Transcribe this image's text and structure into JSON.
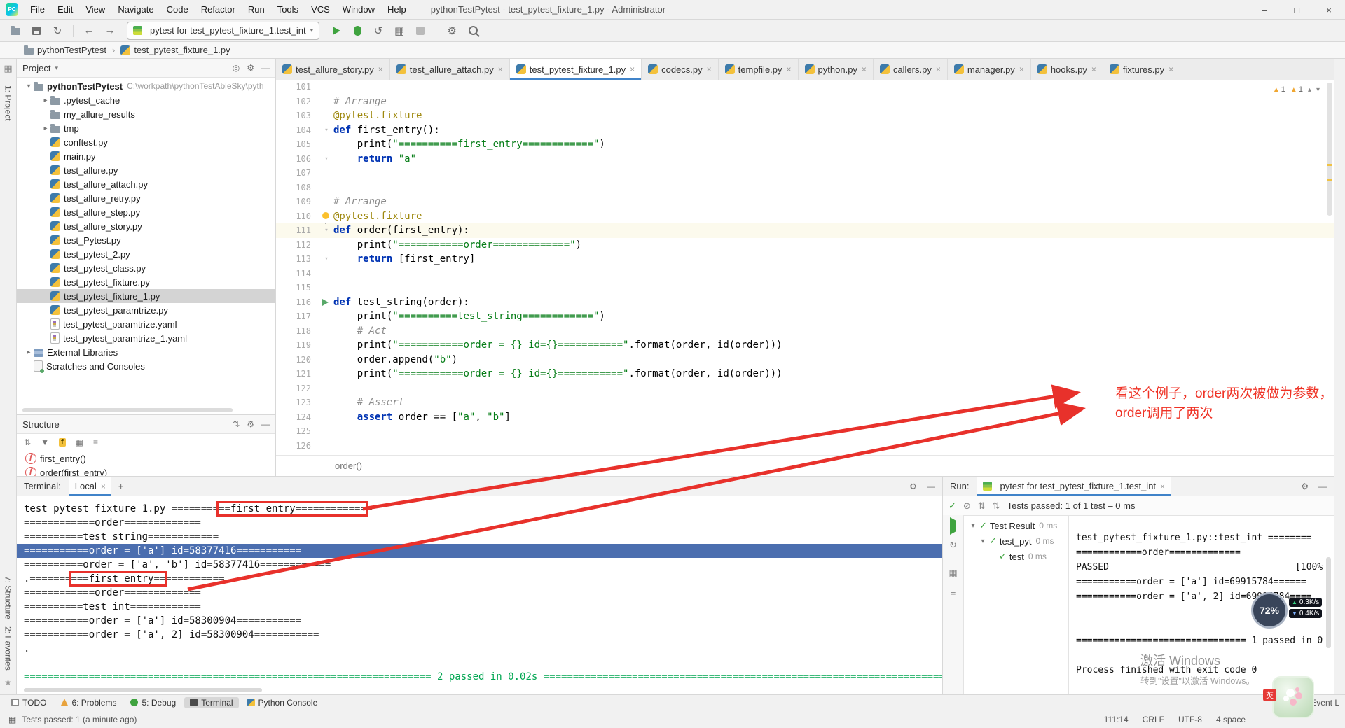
{
  "window": {
    "logo_text": "PC",
    "title": "pythonTestPytest - test_pytest_fixture_1.py - Administrator",
    "menu": [
      "File",
      "Edit",
      "View",
      "Navigate",
      "Code",
      "Refactor",
      "Run",
      "Tools",
      "VCS",
      "Window",
      "Help"
    ]
  },
  "icons": {
    "back": "←",
    "forward": "→",
    "refresh": "↻",
    "undo": "↺",
    "chevron_down": "▾",
    "chevron_up": "▴",
    "chevron_right": "▸",
    "close": "×",
    "add": "+",
    "warning": "▲",
    "check": "✓",
    "slash": "⊘",
    "sort": "⇅",
    "gear": "⚙",
    "minimize": "—",
    "grid": "▦",
    "menu": "≡",
    "min_btn": "–",
    "max_btn": "□",
    "crumb_sep": "›",
    "func": "f",
    "locate": "◎",
    "filter": "▼",
    "star": "★",
    "dot": "•"
  },
  "toolbar": {
    "run_config": "pytest for test_pytest_fixture_1.test_int"
  },
  "breadcrumbs": [
    "pythonTestPytest",
    "test_pytest_fixture_1.py"
  ],
  "left_stripe": {
    "top": [
      "1: Project"
    ],
    "bottom": [
      "7: Structure",
      "2: Favorites"
    ]
  },
  "project": {
    "header": "Project",
    "root_name": "pythonTestPytest",
    "root_path": "C:\\workpath\\pythonTestAbleSky\\pyth",
    "items": [
      {
        "label": ".pytest_cache",
        "icon": "folder",
        "chev": "right",
        "indent": 1
      },
      {
        "label": "my_allure_results",
        "icon": "folder",
        "indent": 1
      },
      {
        "label": "tmp",
        "icon": "folder",
        "chev": "right",
        "indent": 1
      },
      {
        "label": "conftest.py",
        "icon": "py",
        "indent": 1
      },
      {
        "label": "main.py",
        "icon": "py",
        "indent": 1
      },
      {
        "label": "test_allure.py",
        "icon": "py",
        "indent": 1
      },
      {
        "label": "test_allure_attach.py",
        "icon": "py",
        "indent": 1
      },
      {
        "label": "test_allure_retry.py",
        "icon": "py",
        "indent": 1
      },
      {
        "label": "test_allure_step.py",
        "icon": "py",
        "indent": 1
      },
      {
        "label": "test_allure_story.py",
        "icon": "py",
        "indent": 1
      },
      {
        "label": "test_Pytest.py",
        "icon": "py",
        "indent": 1
      },
      {
        "label": "test_pytest_2.py",
        "icon": "py",
        "indent": 1
      },
      {
        "label": "test_pytest_class.py",
        "icon": "py",
        "indent": 1
      },
      {
        "label": "test_pytest_fixture.py",
        "icon": "py",
        "indent": 1
      },
      {
        "label": "test_pytest_fixture_1.py",
        "icon": "py",
        "indent": 1,
        "selected": true
      },
      {
        "label": "test_pytest_paramtrize.py",
        "icon": "py",
        "indent": 1
      },
      {
        "label": "test_pytest_paramtrize.yaml",
        "icon": "yaml",
        "indent": 1
      },
      {
        "label": "test_pytest_paramtrize_1.yaml",
        "icon": "yaml",
        "indent": 1
      },
      {
        "label": "External Libraries",
        "icon": "library",
        "chev": "right",
        "indent": 0
      },
      {
        "label": "Scratches and Consoles",
        "icon": "scratch",
        "indent": 0
      }
    ]
  },
  "structure": {
    "header": "Structure",
    "items": [
      "first_entry()",
      "order(first_entry)"
    ]
  },
  "editor": {
    "tabs": [
      {
        "label": "test_allure_story.py"
      },
      {
        "label": "test_allure_attach.py"
      },
      {
        "label": "test_pytest_fixture_1.py",
        "active": true
      },
      {
        "label": "codecs.py"
      },
      {
        "label": "tempfile.py"
      },
      {
        "label": "python.py"
      },
      {
        "label": "callers.py"
      },
      {
        "label": "manager.py"
      },
      {
        "label": "hooks.py"
      },
      {
        "label": "fixtures.py"
      }
    ],
    "warnings": [
      {
        "count": "1"
      },
      {
        "count": "1"
      }
    ],
    "breadcrumb": "order()",
    "lines": [
      {
        "n": 101,
        "seg": []
      },
      {
        "n": 102,
        "seg": [
          {
            "c": "cm",
            "t": "# Arrange"
          }
        ]
      },
      {
        "n": 103,
        "seg": [
          {
            "c": "dec",
            "t": "@pytest.fixture"
          }
        ]
      },
      {
        "n": 104,
        "fold": true,
        "seg": [
          {
            "c": "kw",
            "t": "def "
          },
          {
            "c": "pl",
            "t": "first_entry():"
          }
        ]
      },
      {
        "n": 105,
        "seg": [
          {
            "c": "pl",
            "t": "    print("
          },
          {
            "c": "str",
            "t": "\"==========first_entry============\""
          },
          {
            "c": "pl",
            "t": ")"
          }
        ]
      },
      {
        "n": 106,
        "fold": true,
        "seg": [
          {
            "c": "kw",
            "t": "    return "
          },
          {
            "c": "str",
            "t": "\"a\""
          }
        ]
      },
      {
        "n": 107,
        "seg": []
      },
      {
        "n": 108,
        "seg": []
      },
      {
        "n": 109,
        "seg": [
          {
            "c": "cm",
            "t": "# Arrange"
          }
        ]
      },
      {
        "n": 110,
        "bulb": true,
        "seg": [
          {
            "c": "dec",
            "t": "@pytest.fixture"
          }
        ]
      },
      {
        "n": 111,
        "current": true,
        "fold": true,
        "seg": [
          {
            "c": "kw",
            "t": "def "
          },
          {
            "c": "pl",
            "t": "order(first_entry):"
          }
        ]
      },
      {
        "n": 112,
        "seg": [
          {
            "c": "pl",
            "t": "    print("
          },
          {
            "c": "str",
            "t": "\"===========order=============\""
          },
          {
            "c": "pl",
            "t": ")"
          }
        ]
      },
      {
        "n": 113,
        "fold": true,
        "seg": [
          {
            "c": "kw",
            "t": "    return "
          },
          {
            "c": "pl",
            "t": "[first_entry]"
          }
        ]
      },
      {
        "n": 114,
        "seg": []
      },
      {
        "n": 115,
        "seg": []
      },
      {
        "n": 116,
        "run": true,
        "seg": [
          {
            "c": "kw",
            "t": "def "
          },
          {
            "c": "pl",
            "t": "test_string(order):"
          }
        ]
      },
      {
        "n": 117,
        "seg": [
          {
            "c": "pl",
            "t": "    print("
          },
          {
            "c": "str",
            "t": "\"==========test_string============\""
          },
          {
            "c": "pl",
            "t": ")"
          }
        ]
      },
      {
        "n": 118,
        "seg": [
          {
            "c": "cm",
            "t": "    # Act"
          }
        ]
      },
      {
        "n": 119,
        "seg": [
          {
            "c": "pl",
            "t": "    print("
          },
          {
            "c": "str",
            "t": "\"===========order = {} id={}===========\""
          },
          {
            "c": "pl",
            "t": ".format(order, id(order)))"
          }
        ]
      },
      {
        "n": 120,
        "seg": [
          {
            "c": "pl",
            "t": "    order.append("
          },
          {
            "c": "str",
            "t": "\"b\""
          },
          {
            "c": "pl",
            "t": ")"
          }
        ]
      },
      {
        "n": 121,
        "seg": [
          {
            "c": "pl",
            "t": "    print("
          },
          {
            "c": "str",
            "t": "\"===========order = {} id={}===========\""
          },
          {
            "c": "pl",
            "t": ".format(order, id(order)))"
          }
        ]
      },
      {
        "n": 122,
        "seg": []
      },
      {
        "n": 123,
        "seg": [
          {
            "c": "cm",
            "t": "    # Assert"
          }
        ]
      },
      {
        "n": 124,
        "seg": [
          {
            "c": "kw",
            "t": "    assert "
          },
          {
            "c": "pl",
            "t": "order == ["
          },
          {
            "c": "str",
            "t": "\"a\""
          },
          {
            "c": "pl",
            "t": ", "
          },
          {
            "c": "str",
            "t": "\"b\""
          },
          {
            "c": "pl",
            "t": "]"
          }
        ]
      },
      {
        "n": 125,
        "seg": []
      },
      {
        "n": 126,
        "seg": []
      }
    ]
  },
  "terminal": {
    "label": "Terminal:",
    "tab": "Local",
    "lines": [
      {
        "seg": [
          {
            "t": "test_pytest_fixture_1.py ========"
          },
          {
            "t": "==first_entry============",
            "box": true
          },
          {
            "t": "="
          }
        ]
      },
      {
        "seg": [
          {
            "t": "============order============="
          }
        ]
      },
      {
        "seg": [
          {
            "t": "==========test_string============"
          }
        ]
      },
      {
        "hl": true,
        "seg": [
          {
            "t": "===========order = ['a'] id=58377416==========="
          }
        ]
      },
      {
        "seg": [
          {
            "t": "==========order = ['a', 'b'] id=58377416============"
          }
        ]
      },
      {
        "seg": [
          {
            "t": ".======="
          },
          {
            "t": "===first_entry==",
            "box": true
          },
          {
            "t": "=========="
          }
        ]
      },
      {
        "seg": [
          {
            "t": "============order============="
          }
        ]
      },
      {
        "seg": [
          {
            "t": "==========test_int============"
          }
        ]
      },
      {
        "seg": [
          {
            "t": "===========order = ['a'] id=58300904==========="
          }
        ]
      },
      {
        "seg": [
          {
            "t": "===========order = ['a', 2] id=58300904==========="
          }
        ]
      },
      {
        "seg": [
          {
            "t": "."
          }
        ]
      },
      {
        "seg": [
          {
            "t": " "
          }
        ]
      },
      {
        "ok": true,
        "seg": [
          {
            "t": "===================================================================== 2 passed in 0.02s ====================================================================="
          }
        ]
      }
    ]
  },
  "run_panel": {
    "label": "Run:",
    "tab": "pytest for test_pytest_fixture_1.test_int",
    "status": "Tests passed: 1 of 1 test – 0 ms",
    "tree": [
      {
        "label": "Test Result",
        "time": "0 ms",
        "indent": 0,
        "chev": true
      },
      {
        "label": "test_pyt",
        "time": "0 ms",
        "indent": 1,
        "chev": true
      },
      {
        "label": "test",
        "time": "0 ms",
        "indent": 2
      }
    ],
    "output": [
      "test_pytest_fixture_1.py::test_int ========",
      "============order=============",
      "PASSED                                  [100%]=",
      "===========order = ['a'] id=69915784======",
      "===========order = ['a', 2] id=69915784====",
      "",
      "",
      "=============================== 1 passed in 0.",
      "",
      "Process finished with exit code 0"
    ]
  },
  "bottom_bar": {
    "items": [
      {
        "label": "TODO",
        "icon": "todo"
      },
      {
        "label": "6: Problems",
        "icon": "problems"
      },
      {
        "label": "5: Debug",
        "icon": "debug"
      },
      {
        "label": "Terminal",
        "icon": "terminal",
        "active": true
      },
      {
        "label": "Python Console",
        "icon": "python-console"
      }
    ],
    "event_log": "Event L"
  },
  "status_bar": {
    "left": "Tests passed: 1 (a minute ago)",
    "right": [
      "111:14",
      "CRLF",
      "UTF-8",
      "4 space"
    ]
  },
  "annotation": {
    "line1": "看这个例子，order两次被做为参数，",
    "line2": "order调用了两次"
  },
  "overlay": {
    "percent": "72%",
    "up": "0.3K/s",
    "down": "0.4K/s",
    "ime": "英"
  },
  "watermark": {
    "line1": "激活 Windows",
    "line2": "转到\"设置\"以激活 Windows。"
  },
  "colors": {
    "accent_blue": "#4083c9",
    "selection_blue": "#4b6eaf",
    "terminal_green": "#00a651",
    "keyword_blue": "#0033b3",
    "string_green": "#067d17",
    "comment_gray": "#8c8c8c",
    "decorator_olive": "#9e880d",
    "annotation_red": "#e8312b"
  }
}
